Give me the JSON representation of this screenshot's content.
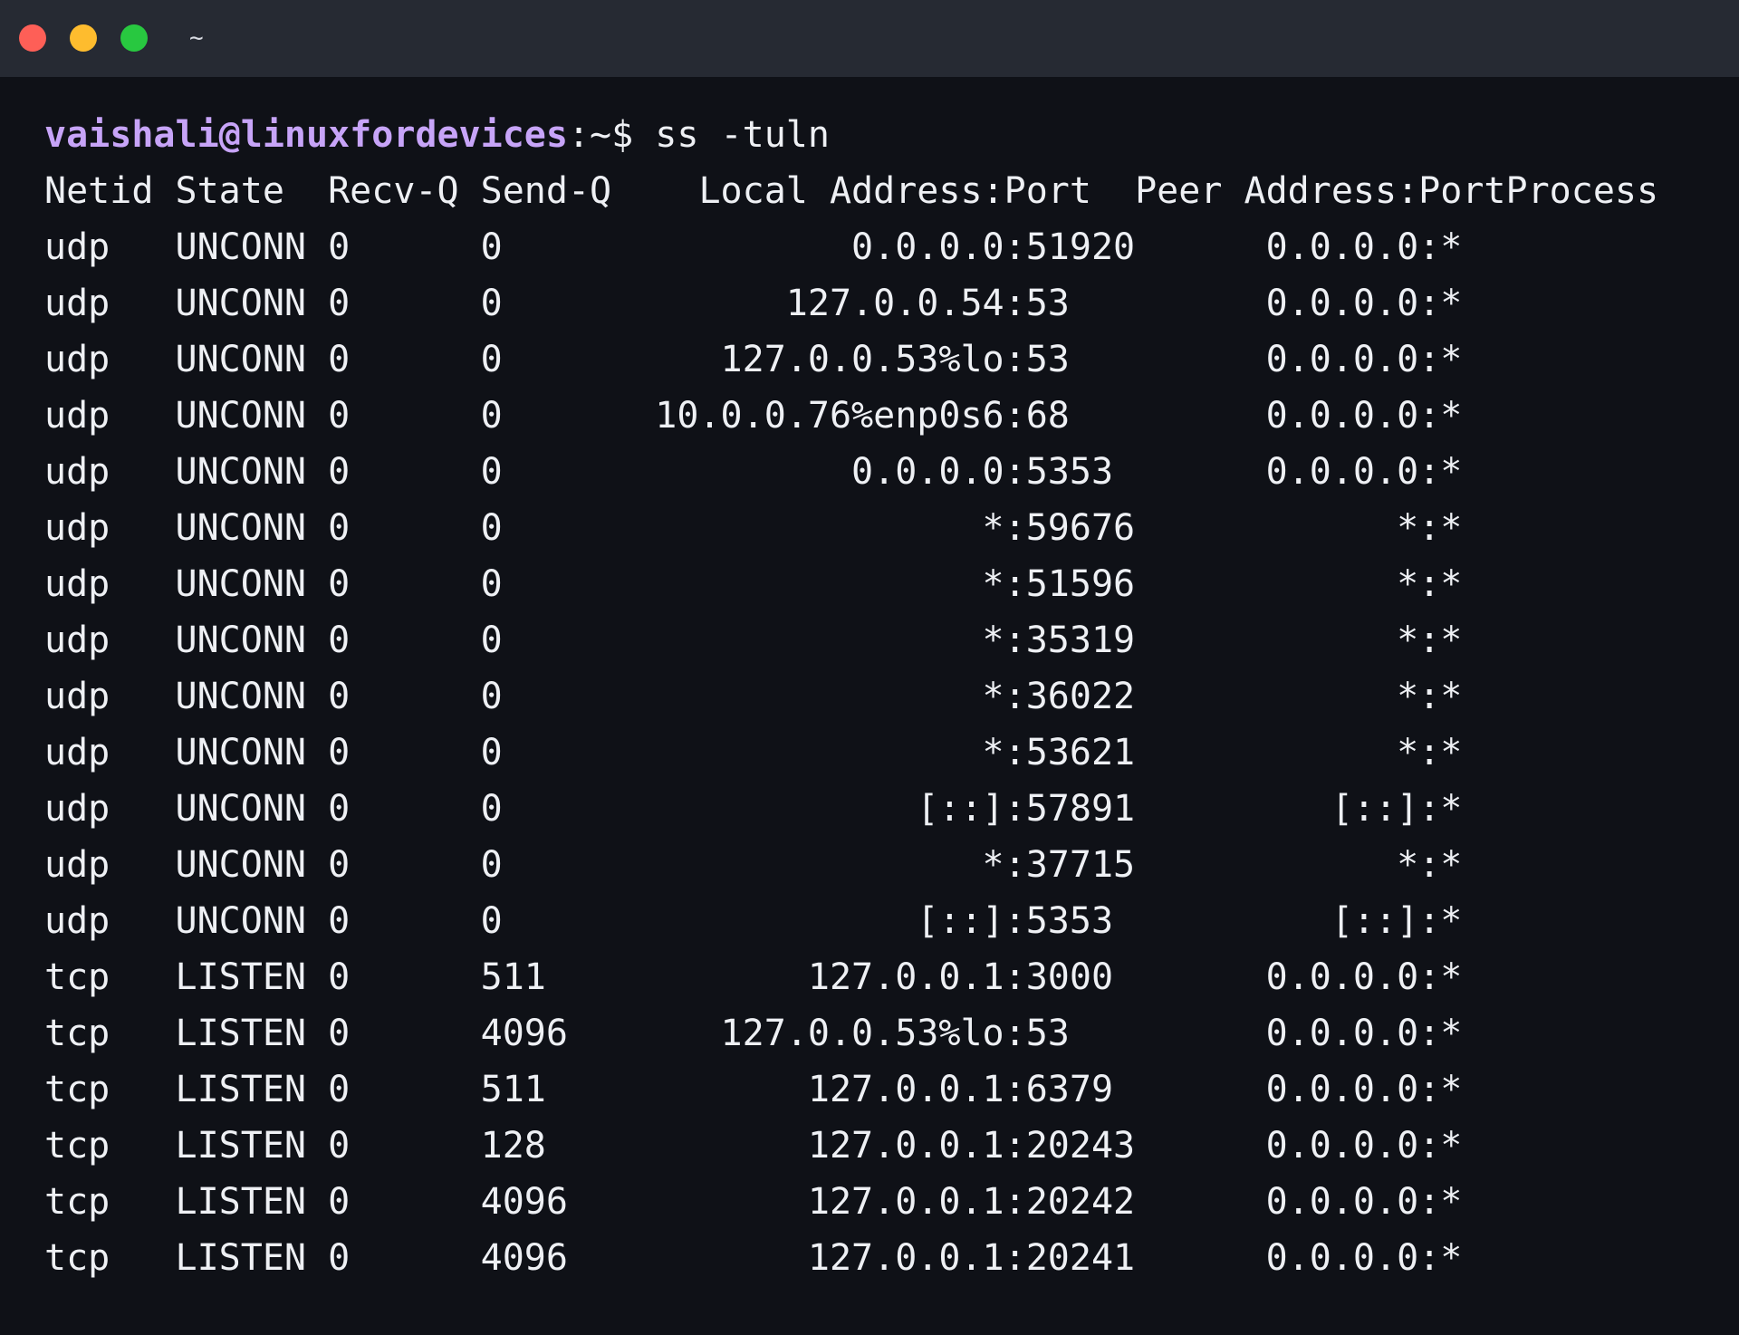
{
  "window": {
    "title": "~",
    "traffic_lights": [
      "red",
      "yellow",
      "green"
    ],
    "colors": {
      "background": "#0f1117",
      "titlebar": "#262a33",
      "text": "#eef0f4",
      "prompt_user": "#c7a4f8",
      "close": "#fe5f57",
      "minimize": "#febc2e",
      "zoom": "#28c840"
    }
  },
  "terminal": {
    "prompt": {
      "user_host": "vaishali@linuxfordevices",
      "path_symbol": ":~$",
      "command": " ss -tuln"
    },
    "header": "Netid State  Recv-Q Send-Q    Local Address:Port  Peer Address:PortProcess",
    "rows": [
      "udp   UNCONN 0      0                0.0.0.0:51920      0.0.0.0:*",
      "udp   UNCONN 0      0             127.0.0.54:53         0.0.0.0:*",
      "udp   UNCONN 0      0          127.0.0.53%lo:53         0.0.0.0:*",
      "udp   UNCONN 0      0       10.0.0.76%enp0s6:68         0.0.0.0:*",
      "udp   UNCONN 0      0                0.0.0.0:5353       0.0.0.0:*",
      "udp   UNCONN 0      0                      *:59676            *:*",
      "udp   UNCONN 0      0                      *:51596            *:*",
      "udp   UNCONN 0      0                      *:35319            *:*",
      "udp   UNCONN 0      0                      *:36022            *:*",
      "udp   UNCONN 0      0                      *:53621            *:*",
      "udp   UNCONN 0      0                   [::]:57891         [::]:*",
      "udp   UNCONN 0      0                      *:37715            *:*",
      "udp   UNCONN 0      0                   [::]:5353          [::]:*",
      "tcp   LISTEN 0      511            127.0.0.1:3000       0.0.0.0:*",
      "tcp   LISTEN 0      4096       127.0.0.53%lo:53         0.0.0.0:*",
      "tcp   LISTEN 0      511            127.0.0.1:6379       0.0.0.0:*",
      "tcp   LISTEN 0      128            127.0.0.1:20243      0.0.0.0:*",
      "tcp   LISTEN 0      4096           127.0.0.1:20242      0.0.0.0:*",
      "tcp   LISTEN 0      4096           127.0.0.1:20241      0.0.0.0:*"
    ]
  }
}
